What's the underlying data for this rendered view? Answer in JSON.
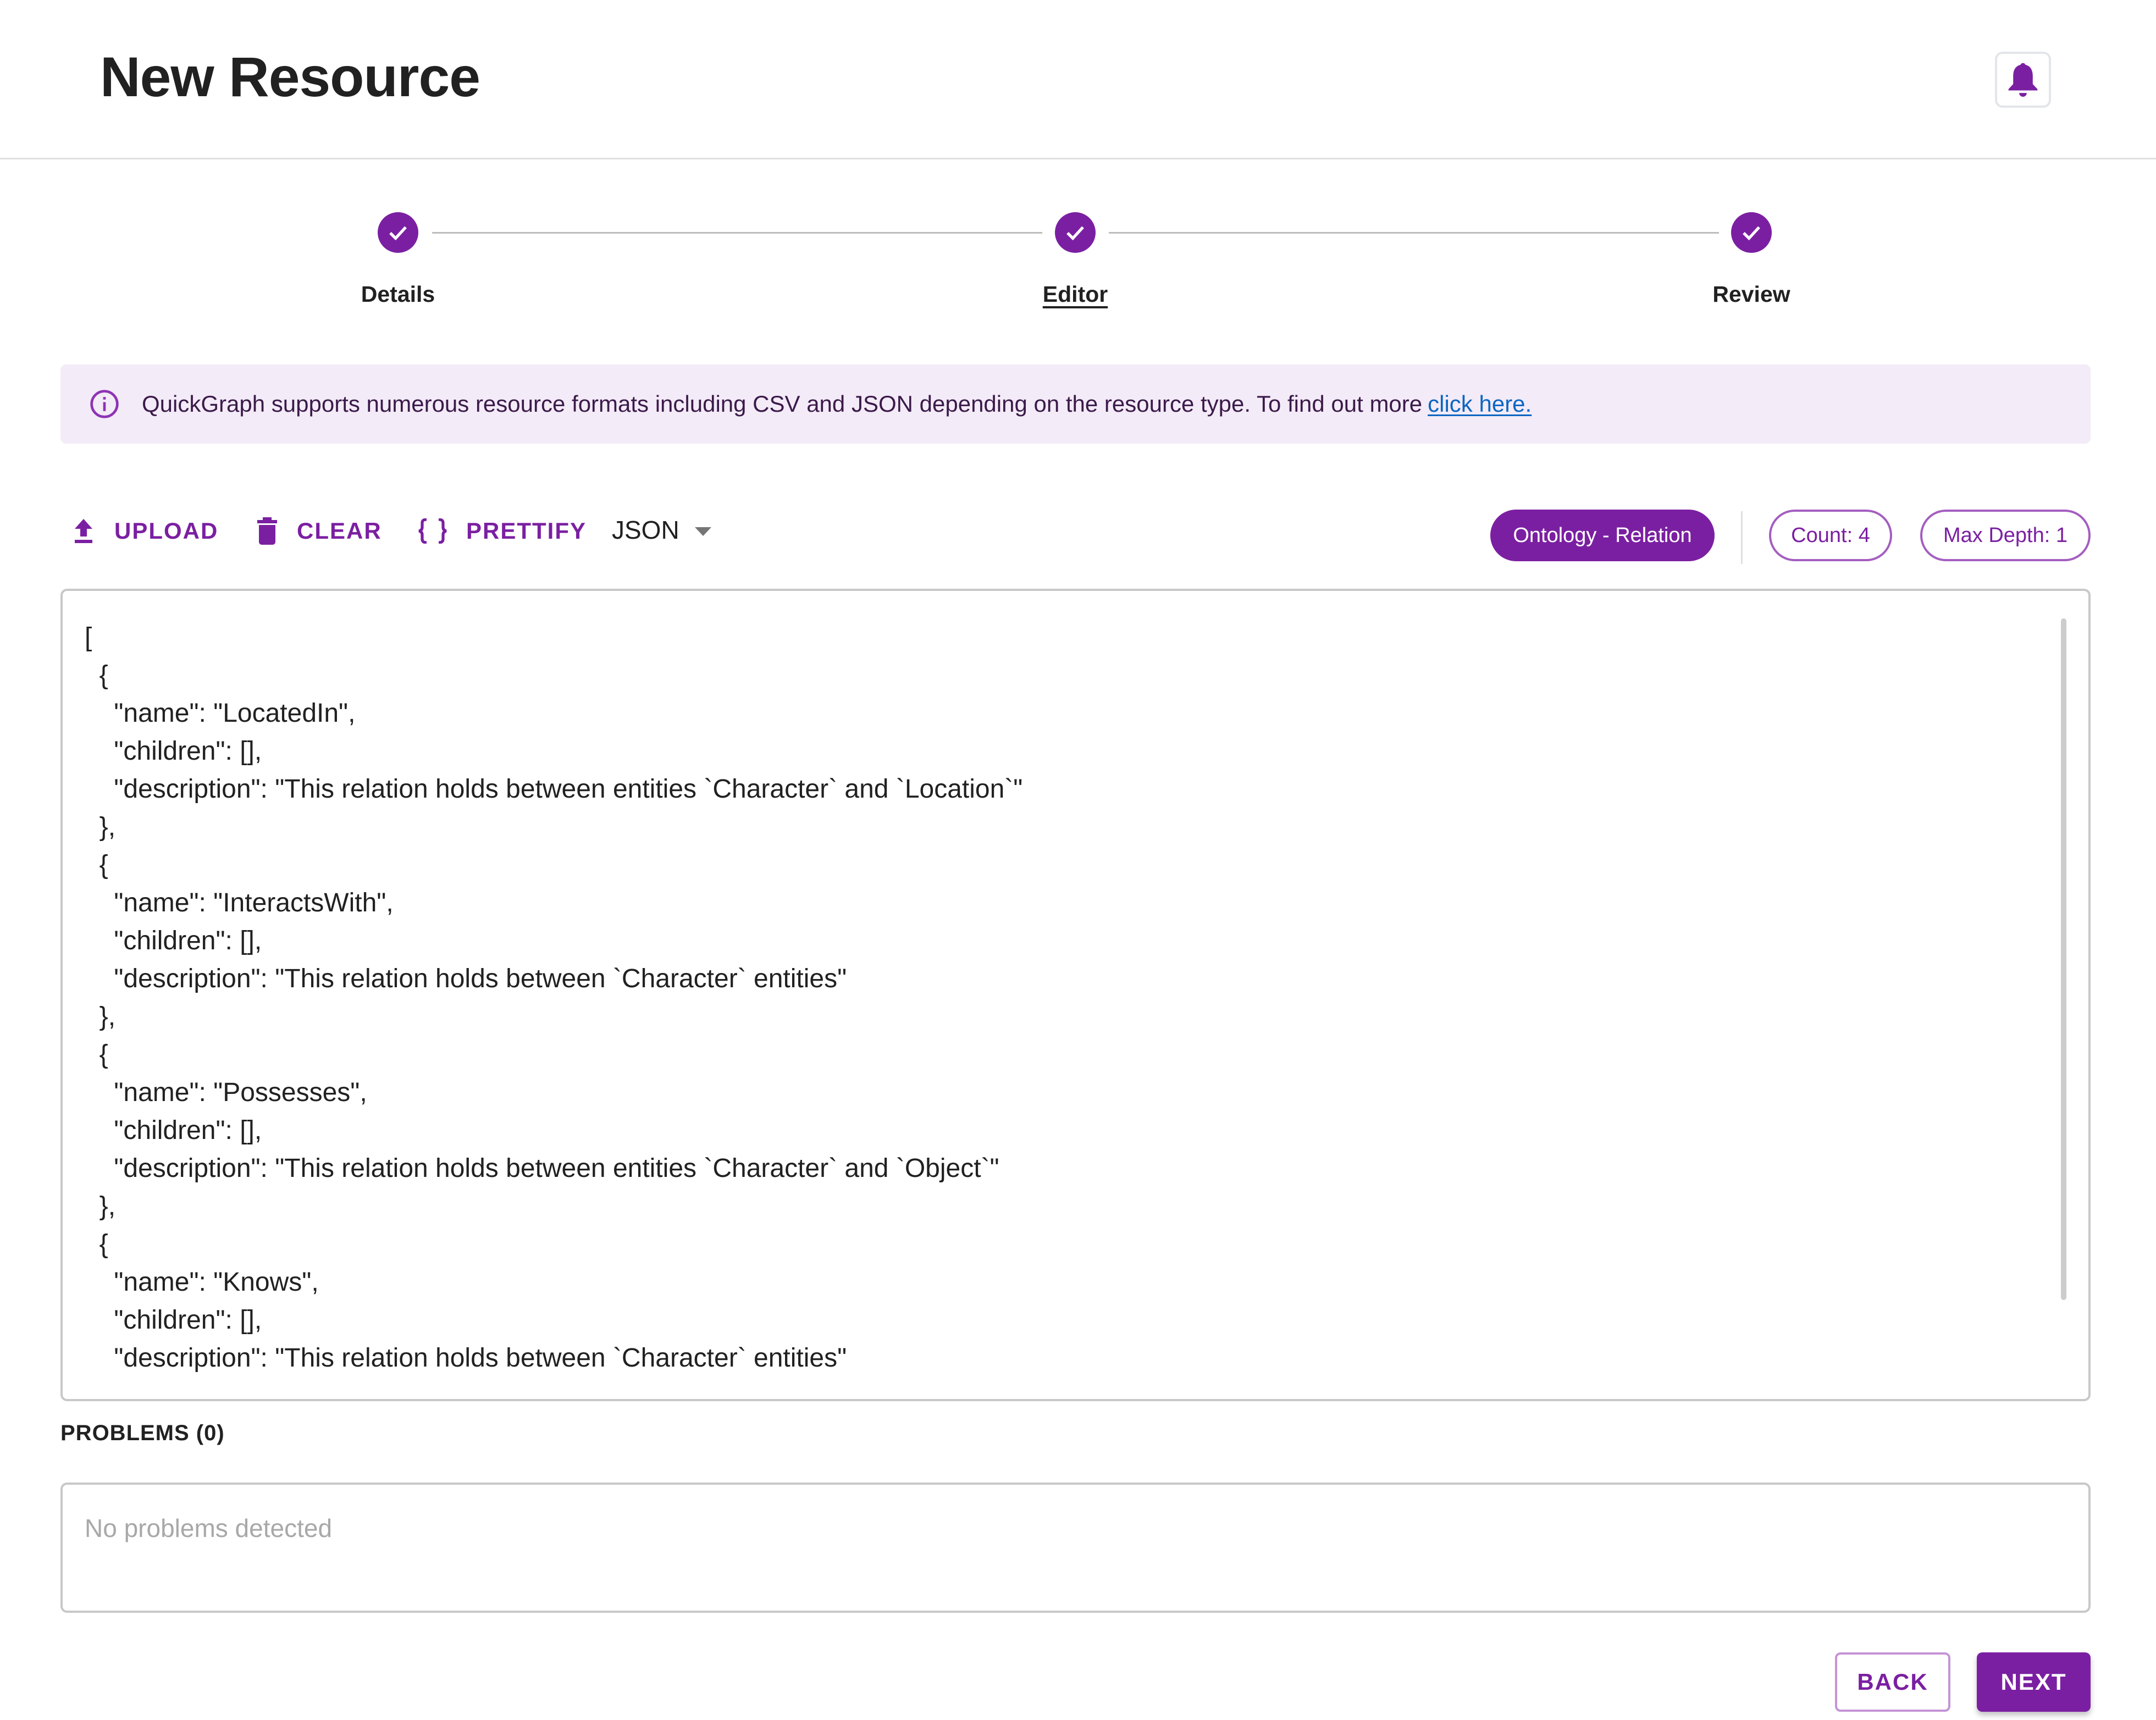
{
  "header": {
    "title": "New Resource",
    "notifications_icon": "bell-icon"
  },
  "stepper": {
    "steps": [
      {
        "label": "Details",
        "status": "completed",
        "active": false
      },
      {
        "label": "Editor",
        "status": "completed",
        "active": true
      },
      {
        "label": "Review",
        "status": "completed",
        "active": false
      }
    ]
  },
  "alert": {
    "icon": "info-icon",
    "text": "QuickGraph supports numerous resource formats including CSV and JSON depending on the resource type. To find out more",
    "link_label": "click here."
  },
  "toolbar": {
    "upload_label": "UPLOAD",
    "clear_label": "CLEAR",
    "prettify_label": "PRETTIFY",
    "format_selected": "JSON",
    "resource_type_chip": "Ontology - Relation",
    "count_chip": "Count: 4",
    "max_depth_chip": "Max Depth: 1"
  },
  "editor": {
    "lines": [
      "[",
      "  {",
      "    \"name\": \"LocatedIn\",",
      "    \"children\": [],",
      "    \"description\": \"This relation holds between entities `Character` and `Location`\"",
      "  },",
      "  {",
      "    \"name\": \"InteractsWith\",",
      "    \"children\": [],",
      "    \"description\": \"This relation holds between `Character` entities\"",
      "  },",
      "  {",
      "    \"name\": \"Possesses\",",
      "    \"children\": [],",
      "    \"description\": \"This relation holds between entities `Character` and `Object`\"",
      "  },",
      "  {",
      "    \"name\": \"Knows\",",
      "    \"children\": [],",
      "    \"description\": \"This relation holds between `Character` entities\""
    ]
  },
  "problems": {
    "label": "PROBLEMS (0)",
    "count": 0,
    "empty_message": "No problems detected"
  },
  "footer": {
    "back_label": "BACK",
    "next_label": "NEXT"
  },
  "colors": {
    "primary": "#7b1fa2",
    "alert_bg": "#f3ebf7",
    "link": "#0a66c2"
  }
}
